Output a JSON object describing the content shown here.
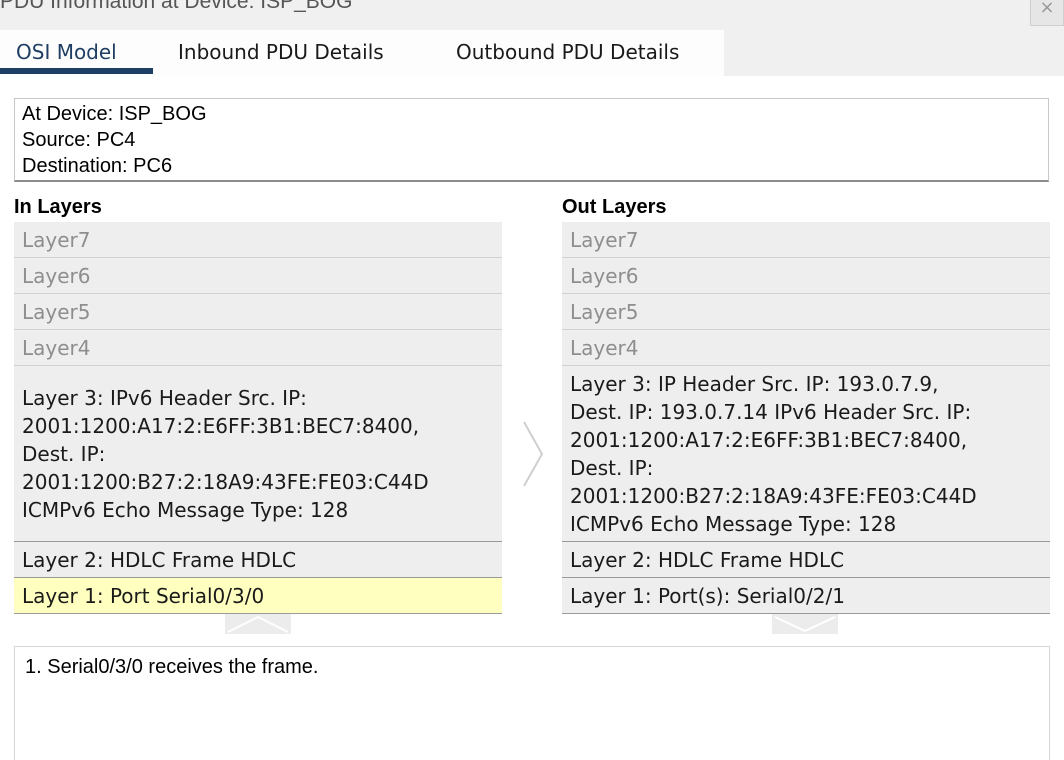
{
  "window": {
    "title": "PDU Information at Device: ISP_BOG",
    "close_glyph": "×"
  },
  "tabs": [
    {
      "label": "OSI Model",
      "active": true
    },
    {
      "label": "Inbound PDU Details",
      "active": false
    },
    {
      "label": "Outbound PDU Details",
      "active": false
    }
  ],
  "info": {
    "at_device": "At Device: ISP_BOG",
    "source": "Source: PC4",
    "destination": "Destination: PC6"
  },
  "in_layers": {
    "heading": "In Layers",
    "layer7": "Layer7",
    "layer6": "Layer6",
    "layer5": "Layer5",
    "layer4": "Layer4",
    "layer3_lines": [
      "Layer 3: IPv6 Header Src. IP:",
      "2001:1200:A17:2:E6FF:3B1:BEC7:8400,",
      "Dest. IP:",
      "2001:1200:B27:2:18A9:43FE:FE03:C44D",
      "ICMPv6 Echo Message Type: 128"
    ],
    "layer2": "Layer 2: HDLC Frame HDLC",
    "layer1": "Layer 1: Port Serial0/3/0"
  },
  "out_layers": {
    "heading": "Out Layers",
    "layer7": "Layer7",
    "layer6": "Layer6",
    "layer5": "Layer5",
    "layer4": "Layer4",
    "layer3_lines": [
      "Layer 3: IP Header Src. IP: 193.0.7.9,",
      "Dest. IP: 193.0.7.14 IPv6 Header Src. IP:",
      "2001:1200:A17:2:E6FF:3B1:BEC7:8400,",
      "Dest. IP:",
      "2001:1200:B27:2:18A9:43FE:FE03:C44D",
      "ICMPv6 Echo Message Type: 128"
    ],
    "layer2": "Layer 2: HDLC Frame HDLC",
    "layer1": "Layer 1: Port(s): Serial0/2/1"
  },
  "description": {
    "text": "1. Serial0/3/0 receives the frame."
  },
  "icons": {
    "direction": "chevron-right-icon",
    "step_up": "chevron-up-icon",
    "step_down": "chevron-down-icon"
  },
  "colors": {
    "accent": "#1f3e63",
    "highlight": "#ffffc0",
    "layer_bg": "#eeeeee"
  }
}
